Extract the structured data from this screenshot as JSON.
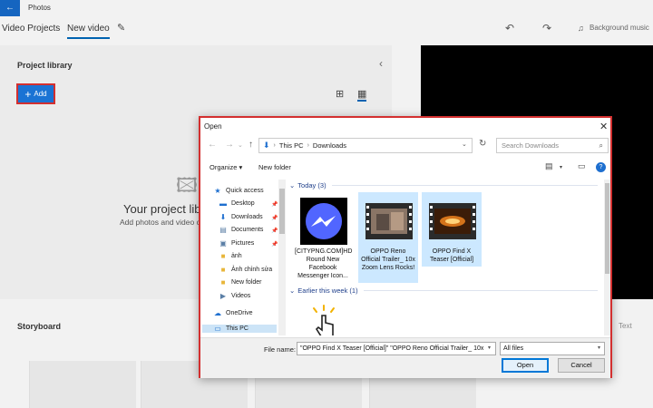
{
  "app": {
    "title": "Photos",
    "tabs": [
      "Video Projects",
      "New video"
    ],
    "background_music": "Background music",
    "project_library": "Project library",
    "add_label": "Add",
    "empty_title": "Your project library",
    "empty_sub": "Add photos and video c",
    "storyboard": "Storyboard",
    "storyboard_action": "Text"
  },
  "dialog": {
    "title": "Open",
    "breadcrumb": [
      "This PC",
      "Downloads"
    ],
    "search_placeholder": "Search Downloads",
    "organize": "Organize",
    "new_folder": "New folder",
    "nav_items": [
      {
        "label": "Quick access",
        "icon": "star-icon",
        "pinned": false
      },
      {
        "label": "Desktop",
        "icon": "desktop-icon",
        "pinned": true
      },
      {
        "label": "Downloads",
        "icon": "download-icon",
        "pinned": true
      },
      {
        "label": "Documents",
        "icon": "document-icon",
        "pinned": true
      },
      {
        "label": "Pictures",
        "icon": "pictures-icon",
        "pinned": true
      },
      {
        "label": "ảnh",
        "icon": "folder-icon",
        "pinned": false
      },
      {
        "label": "Ảnh chỉnh sửa",
        "icon": "folder-icon",
        "pinned": false
      },
      {
        "label": "New folder",
        "icon": "folder-icon",
        "pinned": false
      },
      {
        "label": "Videos",
        "icon": "videos-icon",
        "pinned": false
      },
      {
        "label": "OneDrive",
        "icon": "cloud-icon",
        "pinned": false
      },
      {
        "label": "This PC",
        "icon": "pc-icon",
        "pinned": false
      }
    ],
    "groups": [
      {
        "header": "Today (3)"
      },
      {
        "header": "Earlier this week (1)"
      }
    ],
    "files": [
      {
        "name": "[CITYPNG.COM]HD Round New Facebook Messenger Icon...",
        "selected": false
      },
      {
        "name": "OPPO Reno Official Trailer_ 10x Zoom Lens Rocks!",
        "selected": true
      },
      {
        "name": "OPPO Find X Teaser [Official]",
        "selected": true
      }
    ],
    "file_name_label": "File name:",
    "file_name_value": "\"OPPO Find X Teaser [Official]\" \"OPPO Reno Official Trailer_ 10x",
    "file_type": "All files",
    "open_button": "Open",
    "cancel_button": "Cancel"
  },
  "colors": {
    "accent": "#1a73d4",
    "highlight_border": "#d32f2f",
    "selection": "#cce8ff"
  }
}
